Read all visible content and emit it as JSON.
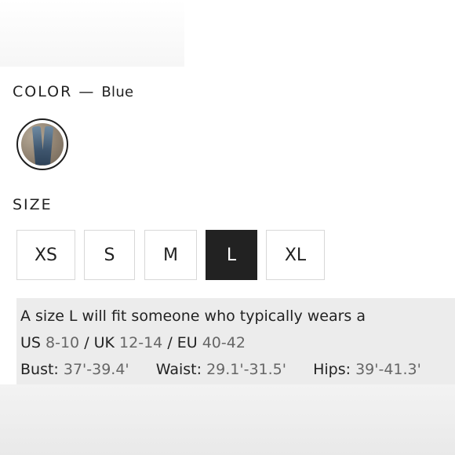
{
  "color": {
    "label": "COLOR",
    "separator": "—",
    "value": "Blue"
  },
  "size": {
    "label": "SIZE",
    "options": [
      "XS",
      "S",
      "M",
      "L",
      "XL"
    ],
    "selected": "L"
  },
  "fit_info": {
    "intro": "A size L will fit someone who typically wears a",
    "us_label": "US",
    "us_value": "8-10",
    "uk_label": "/ UK",
    "uk_value": "12-14",
    "eu_label": "/ EU",
    "eu_value": "40-42",
    "bust_label": "Bust:",
    "bust_value": "37'-39.4'",
    "waist_label": "Waist:",
    "waist_value": "29.1'-31.5'",
    "hips_label": "Hips:",
    "hips_value": "39'-41.3'"
  },
  "colors": {
    "selected_bg": "#222222",
    "panel_bg": "#ececec"
  }
}
